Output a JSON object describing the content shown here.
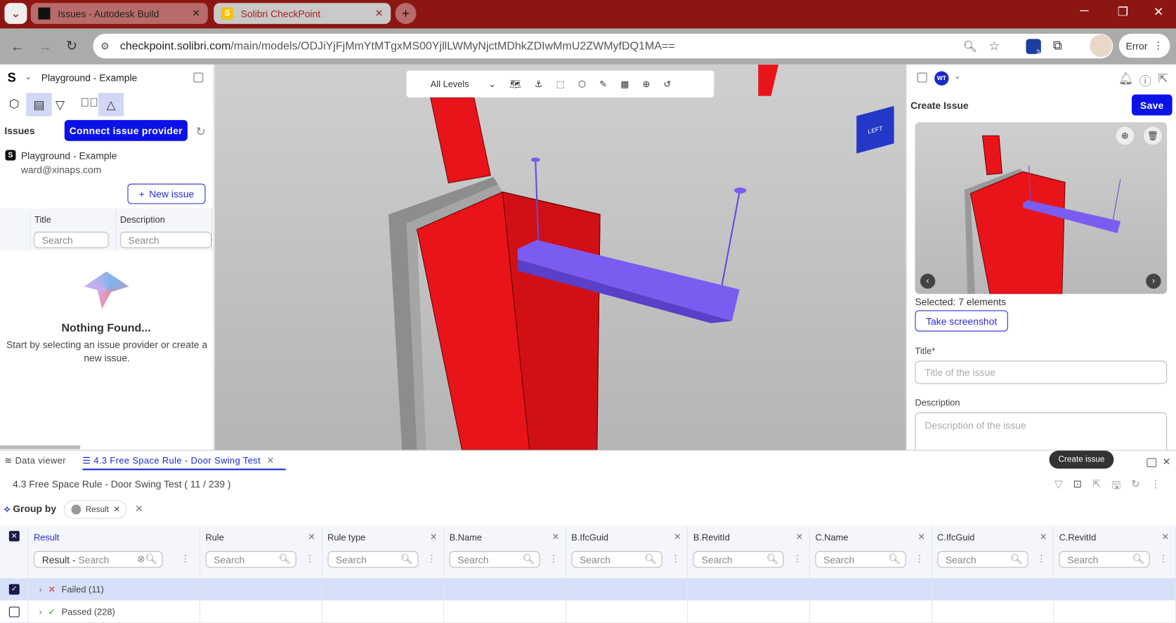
{
  "browser": {
    "tabs": [
      {
        "title": "Issues - Autodesk Build",
        "active": false
      },
      {
        "title": "Solibri CheckPoint",
        "active": true
      }
    ],
    "url_host": "checkpoint.solibri.com",
    "url_path": "/main/models/ODJiYjFjMmYtMTgxMS00YjllLWMyNjctMDhkZDIwMmU2ZWMyfDQ1MA==",
    "extension_badge": "3",
    "profile_status": "Error"
  },
  "left": {
    "project": "Playground - Example",
    "issues_label": "Issues",
    "connect_label": "Connect issue provider",
    "provider_name": "Playground - Example",
    "provider_email": "ward@xinaps.com",
    "new_issue_label": "New issue",
    "columns": [
      "Title",
      "Description"
    ],
    "search_placeholder": "Search",
    "empty_title": "Nothing Found...",
    "empty_text": "Start by selecting an issue provider or create a new issue."
  },
  "viewer": {
    "levels": "All Levels",
    "cube_face": "LEFT"
  },
  "right": {
    "avatar": "WT",
    "heading": "Create Issue",
    "save_label": "Save",
    "selected": "Selected: 7 elements",
    "screenshot_label": "Take screenshot",
    "title_label": "Title*",
    "title_placeholder": "Title of the issue",
    "desc_label": "Description",
    "desc_placeholder": "Description of the issue"
  },
  "bottom": {
    "tab_data_viewer": "Data viewer",
    "tab_rule": "4.3 Free Space Rule - Door Swing Test",
    "heading": "4.3 Free Space Rule - Door Swing Test ( 11 / 239 )",
    "tooltip": "Create issue",
    "group_by": "Group by",
    "group_chip": "Result",
    "columns": [
      "Result",
      "Rule",
      "Rule type",
      "B.Name",
      "B.IfcGuid",
      "B.RevitId",
      "C.Name",
      "C.IfcGuid",
      "C.RevitId"
    ],
    "result_filter_prefix": "Result -",
    "search_placeholder": "Search",
    "rows": [
      {
        "label": "Failed (11)",
        "status": "failed",
        "checked": true
      },
      {
        "label": "Passed (228)",
        "status": "passed",
        "checked": false
      }
    ]
  },
  "colors": {
    "accent": "#0a12e8",
    "browser_frame": "#8c1612",
    "element_red": "#e8141a",
    "element_purple": "#7b5cf0",
    "failed": "#e0303a",
    "passed": "#2a9a3a"
  }
}
